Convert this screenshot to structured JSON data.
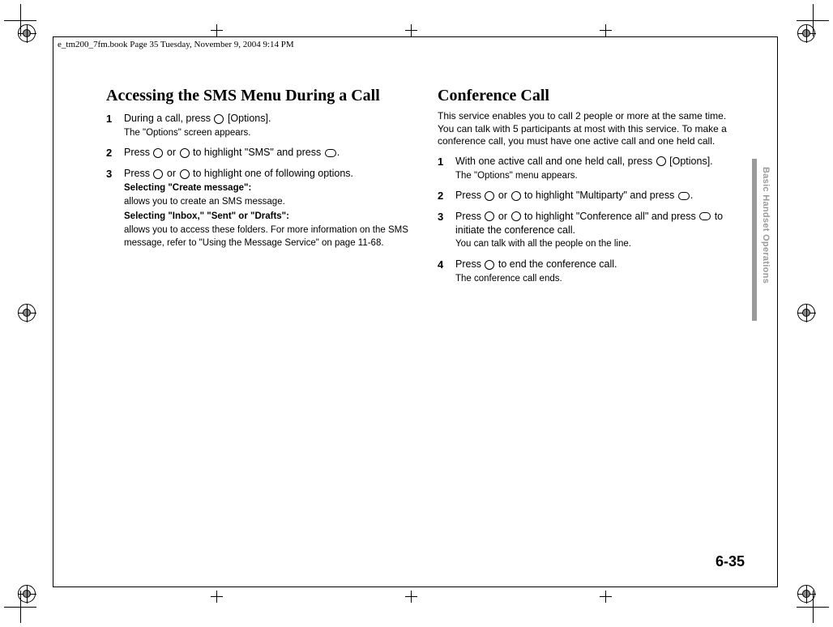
{
  "header": "e_tm200_7fm.book  Page 35  Tuesday, November 9, 2004  9:14 PM",
  "left": {
    "heading": "Accessing the SMS Menu During a Call",
    "step1_a": "During a call, press ",
    "step1_b": " [Options].",
    "step1_note": "The \"Options\" screen appears.",
    "step2_a": "Press ",
    "step2_b": " or ",
    "step2_c": " to highlight \"SMS\" and press ",
    "step2_d": ".",
    "step3_a": "Press ",
    "step3_b": " or ",
    "step3_c": " to highlight one of following options.",
    "step3_sub1": "Selecting \"Create message\":",
    "step3_sub1_text": "allows you to create an SMS message.",
    "step3_sub2": "Selecting \"Inbox,\" \"Sent\" or \"Drafts\":",
    "step3_sub2_text": "allows you to access these folders. For more information on the SMS message, refer to \"Using the Message Service\" on page 11-68."
  },
  "right": {
    "heading": "Conference Call",
    "intro": "This service enables you to call 2 people or more at the same time. You can talk with 5 participants at most with this service. To make a conference call, you must have one active call and one held call.",
    "step1_a": "With one active call and one held call, press ",
    "step1_b": " [Options].",
    "step1_note": "The \"Options\" menu appears.",
    "step2_a": "Press ",
    "step2_b": " or ",
    "step2_c": " to highlight \"Multiparty\" and press ",
    "step2_d": ".",
    "step3_a": "Press ",
    "step3_b": " or ",
    "step3_c": " to highlight \"Conference all\" and press ",
    "step3_d": " to initiate the conference call.",
    "step3_note": "You can talk with all the people on the line.",
    "step4_a": "Press ",
    "step4_b": " to end the conference call.",
    "step4_note": "The conference call ends."
  },
  "side_label": "Basic Handset Operations",
  "page_number": "6-35",
  "nums": {
    "n1": "1",
    "n2": "2",
    "n3": "3",
    "n4": "4"
  }
}
